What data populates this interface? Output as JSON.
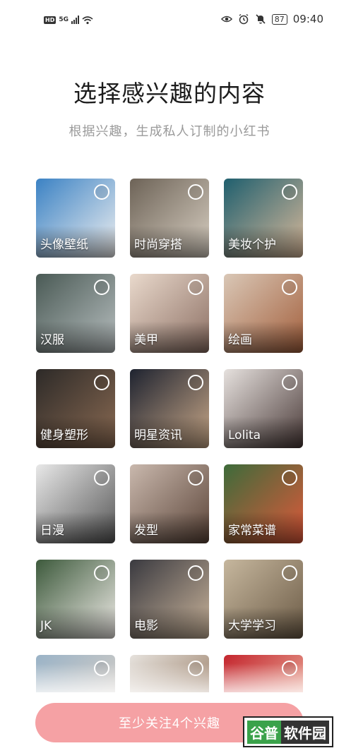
{
  "status_bar": {
    "hd": "HD",
    "network": "5G",
    "battery": "87",
    "time": "09:40",
    "icons": [
      "eye-icon",
      "alarm-icon",
      "mute-bell-icon"
    ]
  },
  "header": {
    "title": "选择感兴趣的内容",
    "subtitle": "根据兴趣，生成私人订制的小红书"
  },
  "interests": [
    {
      "label": "头像壁纸",
      "color_a": "#3b82c4",
      "color_b": "#f0f0f0",
      "selected": false
    },
    {
      "label": "时尚穿搭",
      "color_a": "#6d6357",
      "color_b": "#d8cfc2",
      "selected": false
    },
    {
      "label": "美妆个护",
      "color_a": "#1f5f6e",
      "color_b": "#d9b99a",
      "selected": false
    },
    {
      "label": "汉服",
      "color_a": "#4a5a55",
      "color_b": "#b8bfc0",
      "selected": false
    },
    {
      "label": "美甲",
      "color_a": "#e9d9cc",
      "color_b": "#8c6f63",
      "selected": false
    },
    {
      "label": "绘画",
      "color_a": "#d9c7b6",
      "color_b": "#a35f3c",
      "selected": false
    },
    {
      "label": "健身塑形",
      "color_a": "#2d2a28",
      "color_b": "#8a6a52",
      "selected": false
    },
    {
      "label": "明星资讯",
      "color_a": "#1e2330",
      "color_b": "#c9a888",
      "selected": false
    },
    {
      "label": "Lolita",
      "color_a": "#e6e1de",
      "color_b": "#4a3a38",
      "selected": false
    },
    {
      "label": "日漫",
      "color_a": "#e8e8e8",
      "color_b": "#555555",
      "selected": false
    },
    {
      "label": "发型",
      "color_a": "#c9b8ad",
      "color_b": "#5b4438",
      "selected": false
    },
    {
      "label": "家常菜谱",
      "color_a": "#3d6b3a",
      "color_b": "#e0583a",
      "selected": false
    },
    {
      "label": "JK",
      "color_a": "#3d5a3c",
      "color_b": "#f0ece8",
      "selected": false
    },
    {
      "label": "电影",
      "color_a": "#3a3a40",
      "color_b": "#c9b39a",
      "selected": false
    },
    {
      "label": "大学学习",
      "color_a": "#c6b79e",
      "color_b": "#6b5a45",
      "selected": false
    },
    {
      "label": "",
      "color_a": "#9ab3c7",
      "color_b": "#e3d4c6",
      "selected": false
    },
    {
      "label": "",
      "color_a": "#e6e2dd",
      "color_b": "#8a6a4f",
      "selected": false
    },
    {
      "label": "",
      "color_a": "#c4262e",
      "color_b": "#f2c8b0",
      "selected": false
    }
  ],
  "footer": {
    "cta_label": "至少关注4个兴趣",
    "cta_color": "#f5a1a4"
  },
  "watermark": {
    "part1": "谷普",
    "part2": "软件园"
  }
}
